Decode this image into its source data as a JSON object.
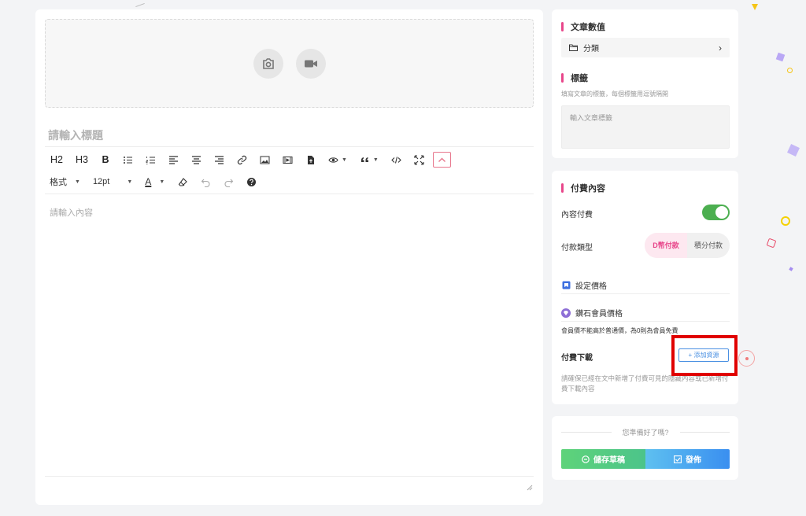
{
  "editor": {
    "title_placeholder": "請輸入標題",
    "content_placeholder": "請輸入內容",
    "toolbar": {
      "h2": "H2",
      "h3": "H3",
      "bold": "B",
      "format_label": "格式",
      "font_size": "12pt",
      "text_color_label": "A"
    }
  },
  "article_settings": {
    "section_title": "文章數值",
    "category_label": "分類",
    "tags_title": "標籤",
    "tags_hint": "填寫文章的標籤，每個標籤用逗號隔開",
    "tags_placeholder": "輸入文章標籤"
  },
  "paid_content": {
    "section_title": "付費內容",
    "content_paid_label": "內容付費",
    "content_paid_enabled": true,
    "payment_type_label": "付款類型",
    "payment_options": [
      "D幣付款",
      "積分付款"
    ],
    "payment_selected": "D幣付款",
    "set_price_label": "設定價格",
    "diamond_price_label": "鑽石會員價格",
    "member_hint": "會員價不能高於普通價，為0則為會員免費",
    "paid_download_label": "付費下載",
    "add_resource_label": "+ 添加資源",
    "download_hint": "請確保已經在文中新增了付費可見的隱藏內容或已新增付費下載內容"
  },
  "publish": {
    "ready_text": "您準備好了嗎?",
    "save_draft_label": "儲存草稿",
    "publish_label": "發佈"
  },
  "colors": {
    "accent_pink": "#e8478b",
    "toggle_green": "#4caf50",
    "link_blue": "#4a90e2",
    "highlight_red": "#e00000"
  }
}
